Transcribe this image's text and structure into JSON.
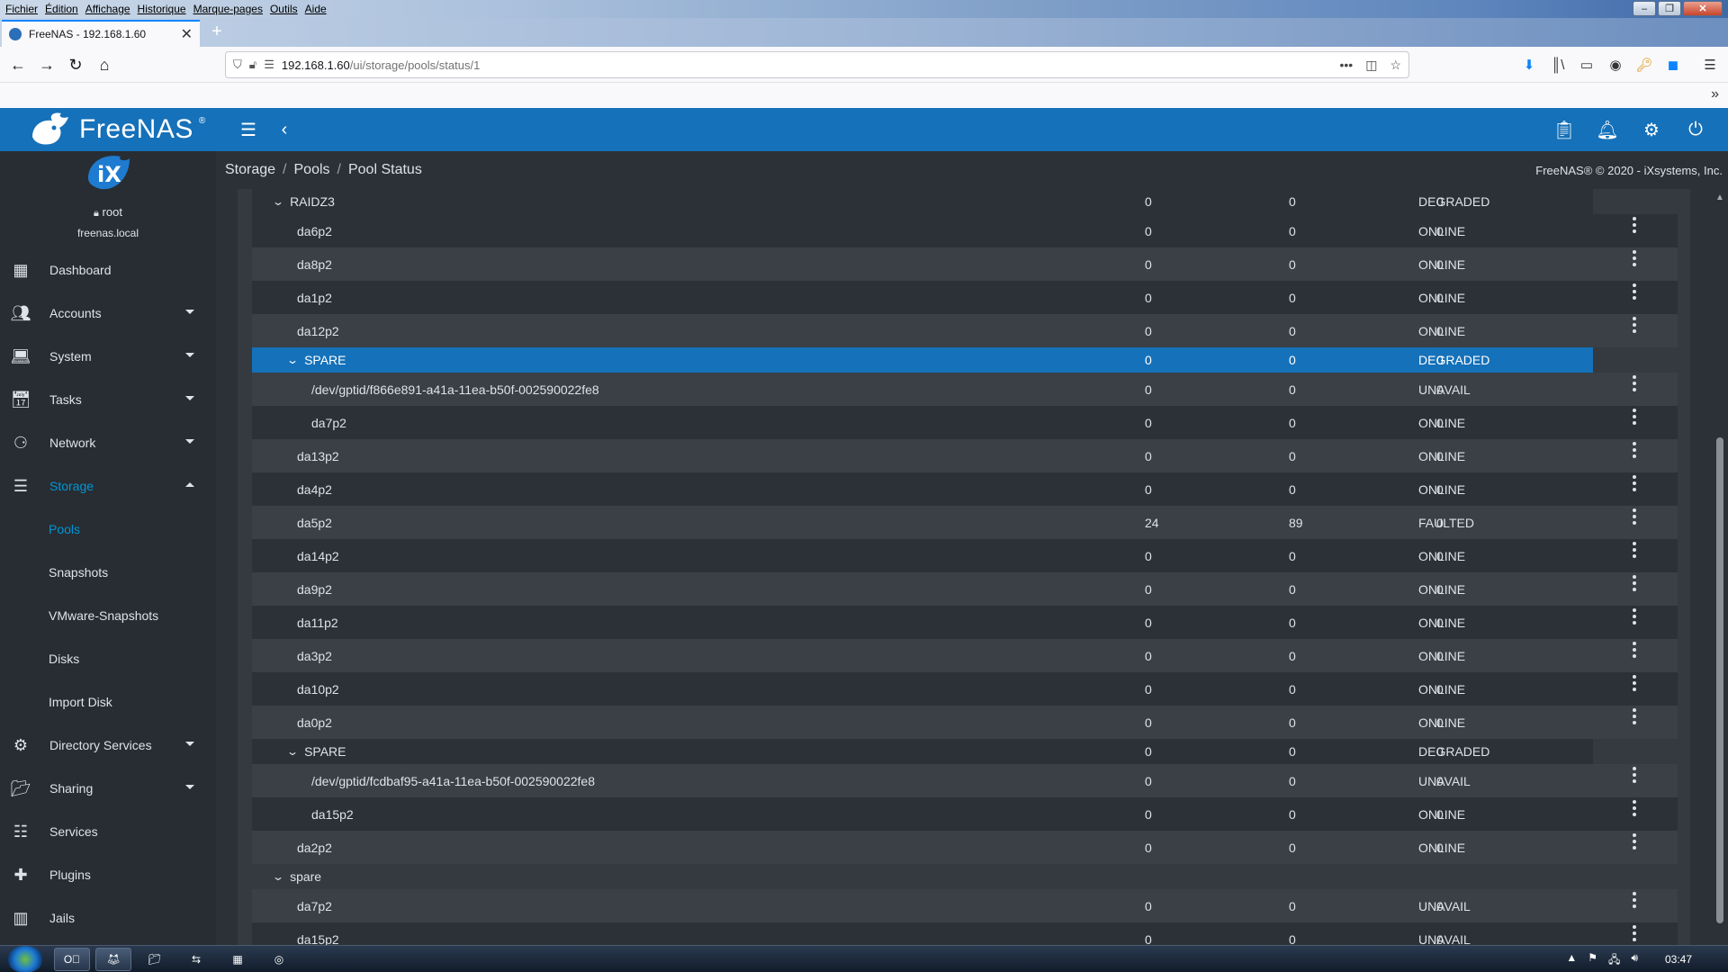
{
  "browser": {
    "menu": [
      "Fichier",
      "Édition",
      "Affichage",
      "Historique",
      "Marque-pages",
      "Outils",
      "Aide"
    ],
    "tab_title": "FreeNAS - 192.168.1.60",
    "url_host": "192.168.1.60",
    "url_path": "/ui/storage/pools/status/1"
  },
  "app": {
    "logo_text": "FreeNAS",
    "logo_tm": "®",
    "ix_text": "iX"
  },
  "user": {
    "name": "root",
    "host": "freenas.local"
  },
  "sidebar": {
    "items": [
      {
        "label": "Dashboard",
        "icon": "dashboard-icon",
        "caret": false
      },
      {
        "label": "Accounts",
        "icon": "people-icon",
        "caret": true
      },
      {
        "label": "System",
        "icon": "laptop-icon",
        "caret": true
      },
      {
        "label": "Tasks",
        "icon": "calendar-icon",
        "caret": true
      },
      {
        "label": "Network",
        "icon": "network-icon",
        "caret": true
      },
      {
        "label": "Storage",
        "icon": "storage-icon",
        "caret": true,
        "expanded": true,
        "active": true
      },
      {
        "label": "Directory Services",
        "icon": "directory-icon",
        "caret": true
      },
      {
        "label": "Sharing",
        "icon": "sharing-icon",
        "caret": true
      },
      {
        "label": "Services",
        "icon": "tune-icon",
        "caret": false
      },
      {
        "label": "Plugins",
        "icon": "puzzle-icon",
        "caret": false
      },
      {
        "label": "Jails",
        "icon": "jail-icon",
        "caret": false
      }
    ],
    "storage_sub": [
      {
        "label": "Pools",
        "active": true
      },
      {
        "label": "Snapshots"
      },
      {
        "label": "VMware-Snapshots"
      },
      {
        "label": "Disks"
      },
      {
        "label": "Import Disk"
      }
    ]
  },
  "breadcrumb": [
    "Storage",
    "Pools",
    "Pool Status"
  ],
  "copyright": "FreeNAS® © 2020 - iXsystems, Inc.",
  "rows": [
    {
      "name": "RAIDZ3",
      "level": 1,
      "chevron": true,
      "read": "0",
      "write": "0",
      "checksum": "0",
      "state": "DEGRADED",
      "menu": false,
      "style": "groupbar-dark"
    },
    {
      "name": "da6p2",
      "level": 2,
      "read": "0",
      "write": "0",
      "checksum": "0",
      "state": "ONLINE",
      "menu": true,
      "style": "dark"
    },
    {
      "name": "da8p2",
      "level": 2,
      "read": "0",
      "write": "0",
      "checksum": "0",
      "state": "ONLINE",
      "menu": true,
      "style": "light"
    },
    {
      "name": "da1p2",
      "level": 2,
      "read": "0",
      "write": "0",
      "checksum": "0",
      "state": "ONLINE",
      "menu": true,
      "style": "dark"
    },
    {
      "name": "da12p2",
      "level": 2,
      "read": "0",
      "write": "0",
      "checksum": "0",
      "state": "ONLINE",
      "menu": true,
      "style": "light"
    },
    {
      "name": "SPARE",
      "level": 2,
      "chevron": true,
      "read": "0",
      "write": "0",
      "checksum": "0",
      "state": "DEGRADED",
      "menu": false,
      "style": "selected"
    },
    {
      "name": "/dev/gptid/f866e891-a41a-11ea-b50f-002590022fe8",
      "level": 3,
      "read": "0",
      "write": "0",
      "checksum": "0",
      "state": "UNAVAIL",
      "menu": true,
      "style": "light"
    },
    {
      "name": "da7p2",
      "level": 3,
      "read": "0",
      "write": "0",
      "checksum": "0",
      "state": "ONLINE",
      "menu": true,
      "style": "dark"
    },
    {
      "name": "da13p2",
      "level": 2,
      "read": "0",
      "write": "0",
      "checksum": "0",
      "state": "ONLINE",
      "menu": true,
      "style": "light"
    },
    {
      "name": "da4p2",
      "level": 2,
      "read": "0",
      "write": "0",
      "checksum": "0",
      "state": "ONLINE",
      "menu": true,
      "style": "dark"
    },
    {
      "name": "da5p2",
      "level": 2,
      "read": "24",
      "write": "89",
      "checksum": "0",
      "state": "FAULTED",
      "menu": true,
      "style": "light"
    },
    {
      "name": "da14p2",
      "level": 2,
      "read": "0",
      "write": "0",
      "checksum": "0",
      "state": "ONLINE",
      "menu": true,
      "style": "dark"
    },
    {
      "name": "da9p2",
      "level": 2,
      "read": "0",
      "write": "0",
      "checksum": "0",
      "state": "ONLINE",
      "menu": true,
      "style": "light"
    },
    {
      "name": "da11p2",
      "level": 2,
      "read": "0",
      "write": "0",
      "checksum": "0",
      "state": "ONLINE",
      "menu": true,
      "style": "dark"
    },
    {
      "name": "da3p2",
      "level": 2,
      "read": "0",
      "write": "0",
      "checksum": "0",
      "state": "ONLINE",
      "menu": true,
      "style": "light"
    },
    {
      "name": "da10p2",
      "level": 2,
      "read": "0",
      "write": "0",
      "checksum": "0",
      "state": "ONLINE",
      "menu": true,
      "style": "dark"
    },
    {
      "name": "da0p2",
      "level": 2,
      "read": "0",
      "write": "0",
      "checksum": "0",
      "state": "ONLINE",
      "menu": true,
      "style": "light"
    },
    {
      "name": "SPARE",
      "level": 2,
      "chevron": true,
      "read": "0",
      "write": "0",
      "checksum": "0",
      "state": "DEGRADED",
      "menu": false,
      "style": "groupbar-dark"
    },
    {
      "name": "/dev/gptid/fcdbaf95-a41a-11ea-b50f-002590022fe8",
      "level": 3,
      "read": "0",
      "write": "0",
      "checksum": "0",
      "state": "UNAVAIL",
      "menu": true,
      "style": "light"
    },
    {
      "name": "da15p2",
      "level": 3,
      "read": "0",
      "write": "0",
      "checksum": "0",
      "state": "ONLINE",
      "menu": true,
      "style": "dark"
    },
    {
      "name": "da2p2",
      "level": 2,
      "read": "0",
      "write": "0",
      "checksum": "0",
      "state": "ONLINE",
      "menu": true,
      "style": "light"
    },
    {
      "name": "spare",
      "level": 1,
      "chevron": true,
      "read": "",
      "write": "",
      "checksum": "",
      "state": "",
      "menu": false,
      "style": "groupbar-plain"
    },
    {
      "name": "da7p2",
      "level": 2,
      "read": "0",
      "write": "0",
      "checksum": "0",
      "state": "UNAVAIL",
      "menu": true,
      "style": "light"
    },
    {
      "name": "da15p2",
      "level": 2,
      "read": "0",
      "write": "0",
      "checksum": "0",
      "state": "UNAVAIL",
      "menu": true,
      "style": "dark"
    }
  ],
  "taskbar": {
    "clock": "03:47"
  }
}
